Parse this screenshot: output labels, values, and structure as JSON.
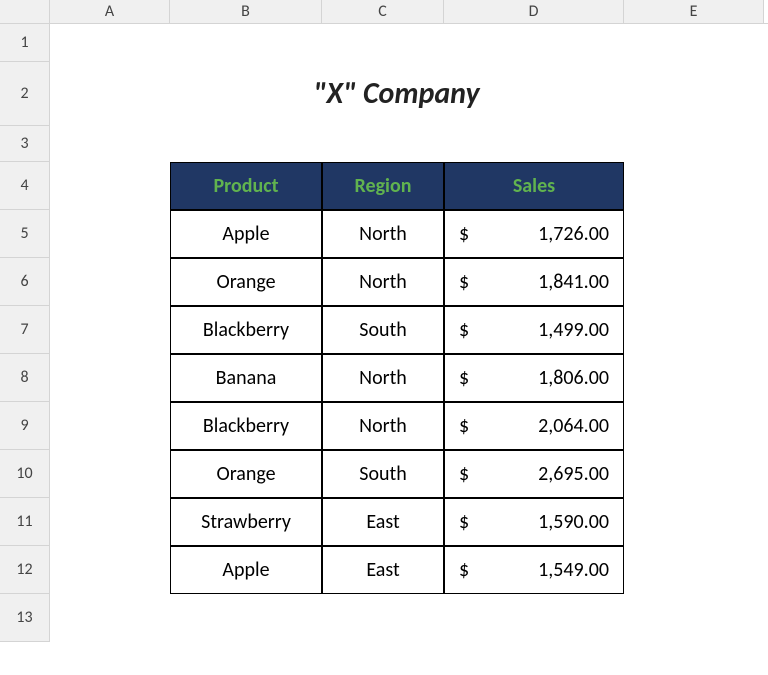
{
  "columns": [
    "A",
    "B",
    "C",
    "D",
    "E"
  ],
  "rows": [
    "1",
    "2",
    "3",
    "4",
    "5",
    "6",
    "7",
    "8",
    "9",
    "10",
    "11",
    "12",
    "13"
  ],
  "title": "\"X\" Company",
  "table": {
    "headers": {
      "product": "Product",
      "region": "Region",
      "sales": "Sales"
    },
    "rows": [
      {
        "product": "Apple",
        "region": "North",
        "currency": "$",
        "sales": "1,726.00"
      },
      {
        "product": "Orange",
        "region": "North",
        "currency": "$",
        "sales": "1,841.00"
      },
      {
        "product": "Blackberry",
        "region": "South",
        "currency": "$",
        "sales": "1,499.00"
      },
      {
        "product": "Banana",
        "region": "North",
        "currency": "$",
        "sales": "1,806.00"
      },
      {
        "product": "Blackberry",
        "region": "North",
        "currency": "$",
        "sales": "2,064.00"
      },
      {
        "product": "Orange",
        "region": "South",
        "currency": "$",
        "sales": "2,695.00"
      },
      {
        "product": "Strawberry",
        "region": "East",
        "currency": "$",
        "sales": "1,590.00"
      },
      {
        "product": "Apple",
        "region": "East",
        "currency": "$",
        "sales": "1,549.00"
      }
    ]
  }
}
